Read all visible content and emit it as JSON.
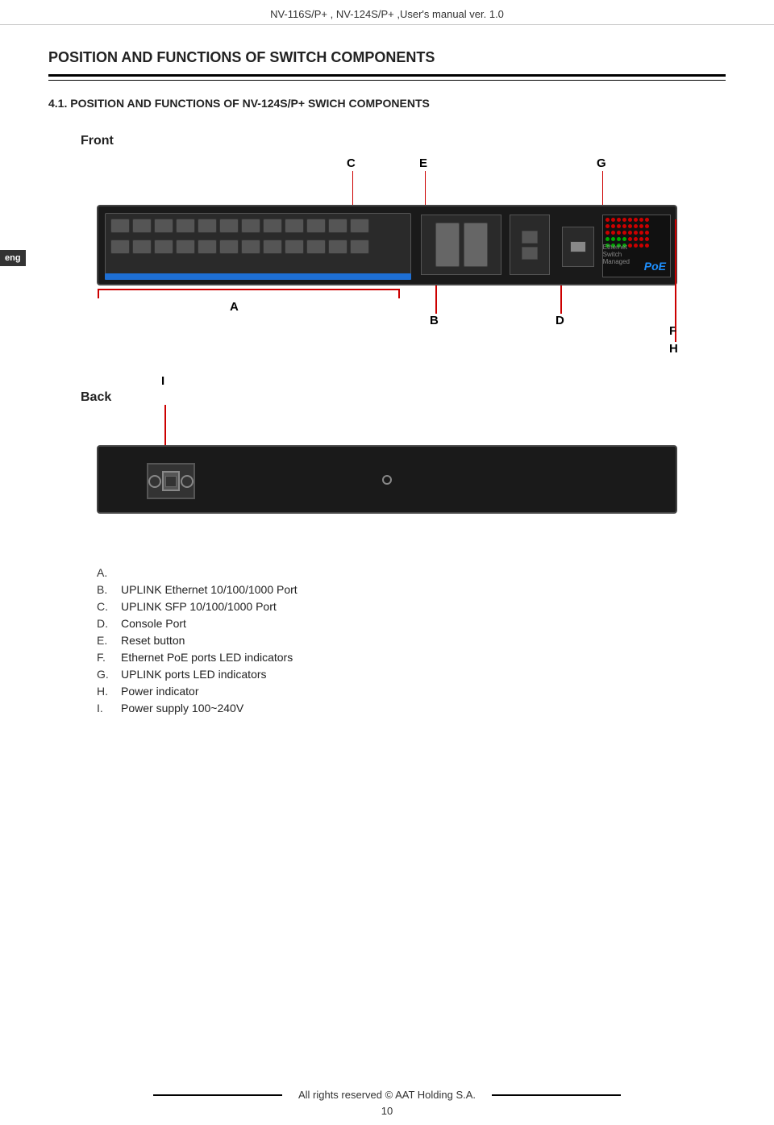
{
  "header": {
    "title": "NV-116S/P+ , NV-124S/P+ ,User's manual ver. 1.0"
  },
  "eng_tab": "eng",
  "section": {
    "title": "POSITION AND FUNCTIONS OF SWITCH COMPONENTS",
    "sub_title": "4.1.   POSITION AND FUNCTIONS OF  NV-124S/P+  SWICH COMPONENTS"
  },
  "diagram": {
    "front_label": "Front",
    "back_label": "Back",
    "annotations": {
      "A": "A",
      "B": "B",
      "C": "C",
      "D": "D",
      "E": "E",
      "F": "F",
      "G": "G",
      "H": "H",
      "I": "I"
    }
  },
  "items": [
    {
      "letter": "A.",
      "text": ""
    },
    {
      "letter": "B.",
      "text": "UPLINK Ethernet 10/100/1000 Port"
    },
    {
      "letter": "C.",
      "text": "UPLINK SFP 10/100/1000 Port"
    },
    {
      "letter": "D.",
      "text": "Console Port"
    },
    {
      "letter": "E.",
      "text": "Reset button"
    },
    {
      "letter": "F.",
      "text": "Ethernet PoE ports LED indicators"
    },
    {
      "letter": "G.",
      "text": "UPLINK ports LED indicators"
    },
    {
      "letter": "H.",
      "text": "Power indicator"
    },
    {
      "letter": "I.",
      "text": "Power supply 100~240V"
    }
  ],
  "footer": {
    "text": "All rights reserved © AAT Holding S.A.",
    "page": "10"
  }
}
